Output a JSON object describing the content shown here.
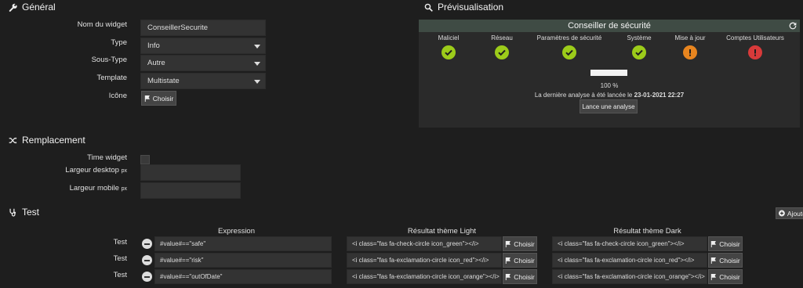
{
  "general": {
    "title": "Général",
    "fields": {
      "name_label": "Nom du widget",
      "name_value": "ConseillerSecurite",
      "type_label": "Type",
      "type_value": "Info",
      "subtype_label": "Sous-Type",
      "subtype_value": "Autre",
      "template_label": "Template",
      "template_value": "Multistate",
      "icon_label": "Icône",
      "choose_label": "Choisir"
    }
  },
  "preview": {
    "title": "Prévisualisation",
    "widget_title": "Conseiller de sécurité",
    "categories": [
      {
        "label": "Maliciel",
        "status": "ok",
        "color": "#9ccc1a"
      },
      {
        "label": "Réseau",
        "status": "ok",
        "color": "#9ccc1a"
      },
      {
        "label": "Paramètres de sécurité",
        "status": "ok",
        "color": "#9ccc1a"
      },
      {
        "label": "Système",
        "status": "ok",
        "color": "#9ccc1a"
      },
      {
        "label": "Mise à jour",
        "status": "warning",
        "color": "#e8851f"
      },
      {
        "label": "Comptes Utilisateurs",
        "status": "danger",
        "color": "#d83a3a"
      }
    ],
    "progress_percent": 100,
    "progress_text": "100 %",
    "last_scan_prefix": "La dernière analyse à été lancée le",
    "last_scan_date": "23-01-2021 22:27",
    "scan_button": "Lance une analyse"
  },
  "replacement": {
    "title": "Remplacement",
    "time_widget_label": "Time widget",
    "desktop_width_label": "Largeur desktop",
    "mobile_width_label": "Largeur mobile",
    "unit": "px"
  },
  "test": {
    "title": "Test",
    "add_button": "Ajoute",
    "headers": {
      "expression": "Expression",
      "light": "Résultat thème Light",
      "dark": "Résultat thème Dark"
    },
    "row_label": "Test",
    "choose_label": "Choisir",
    "rows": [
      {
        "expression": "#value#==\"safe\"",
        "light": "<i class=\"fas fa-check-circle  icon_green\"></i>",
        "dark": "<i class=\"fas fa-check-circle  icon_green\"></i>"
      },
      {
        "expression": "#value#==\"risk\"",
        "light": "<i class=\"fas fa-exclamation-circle icon_red\"></i>",
        "dark": "<i class=\"fas fa-exclamation-circle icon_red\"></i>"
      },
      {
        "expression": "#value#==\"outOfDate\"",
        "light": "<i class=\"fas fa-exclamation-circle icon_orange\"></i>",
        "dark": "<i class=\"fas fa-exclamation-circle icon_orange\"></i>"
      }
    ]
  },
  "icons": {
    "general": "wrench-icon",
    "preview": "search-icon",
    "replacement": "shuffle-icon",
    "test": "stethoscope-icon",
    "flag": "flag-icon",
    "refresh": "refresh-icon",
    "add": "plus-circle-icon"
  }
}
